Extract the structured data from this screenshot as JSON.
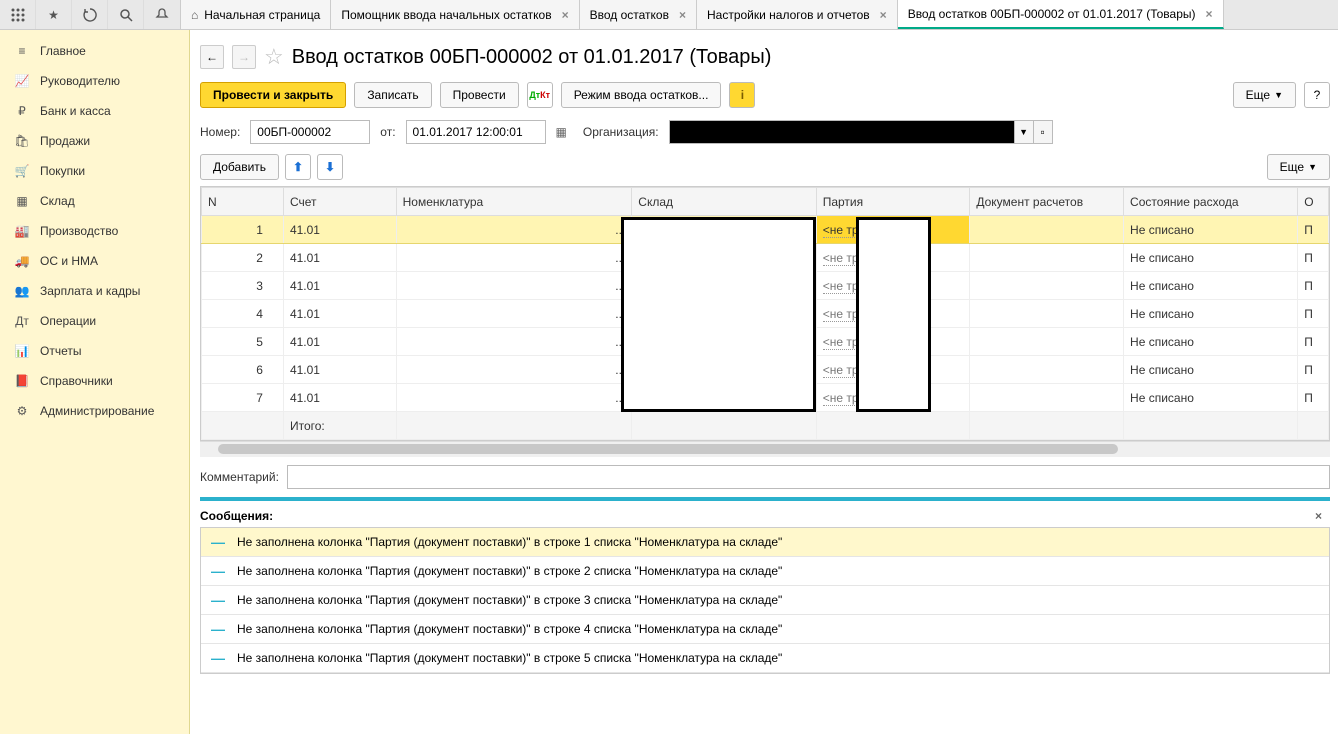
{
  "tabs": [
    {
      "label": "Начальная страница",
      "home": true
    },
    {
      "label": "Помощник ввода начальных остатков"
    },
    {
      "label": "Ввод остатков"
    },
    {
      "label": "Настройки налогов и отчетов"
    },
    {
      "label": "Ввод остатков 00БП-000002 от 01.01.2017 (Товары)",
      "active": true
    }
  ],
  "sidebar": [
    {
      "label": "Главное",
      "icon": "menu"
    },
    {
      "label": "Руководителю",
      "icon": "chart"
    },
    {
      "label": "Банк и касса",
      "icon": "ruble"
    },
    {
      "label": "Продажи",
      "icon": "bag"
    },
    {
      "label": "Покупки",
      "icon": "cart"
    },
    {
      "label": "Склад",
      "icon": "warehouse"
    },
    {
      "label": "Производство",
      "icon": "factory"
    },
    {
      "label": "ОС и НМА",
      "icon": "truck"
    },
    {
      "label": "Зарплата и кадры",
      "icon": "people"
    },
    {
      "label": "Операции",
      "icon": "dtkt"
    },
    {
      "label": "Отчеты",
      "icon": "bars"
    },
    {
      "label": "Справочники",
      "icon": "book"
    },
    {
      "label": "Администрирование",
      "icon": "gear"
    }
  ],
  "doc": {
    "title": "Ввод остатков 00БП-000002 от 01.01.2017 (Товары)"
  },
  "actions": {
    "post_and_close": "Провести и закрыть",
    "save": "Записать",
    "post": "Провести",
    "mode": "Режим ввода остатков...",
    "more": "Еще"
  },
  "fields": {
    "number_label": "Номер:",
    "number_value": "00БП-000002",
    "from_label": "от:",
    "date_value": "01.01.2017 12:00:01",
    "org_label": "Организация:"
  },
  "tbl_toolbar": {
    "add": "Добавить",
    "more": "Еще"
  },
  "columns": {
    "n": "N",
    "acct": "Счет",
    "nom": "Номенклатура",
    "skl": "Склад",
    "party": "Партия",
    "doc": "Документ расчетов",
    "state": "Состояние расхода",
    "o": "О"
  },
  "rows": [
    {
      "n": "1",
      "acct": "41.01",
      "party": "<не требуется>",
      "state": "Не списано",
      "o": "П",
      "selected": true
    },
    {
      "n": "2",
      "acct": "41.01",
      "party": "<не требуется>",
      "state": "Не списано",
      "o": "П"
    },
    {
      "n": "3",
      "acct": "41.01",
      "party": "<не требуется>",
      "state": "Не списано",
      "o": "П"
    },
    {
      "n": "4",
      "acct": "41.01",
      "party": "<не требуется>",
      "state": "Не списано",
      "o": "П"
    },
    {
      "n": "5",
      "acct": "41.01",
      "party": "<не требуется>",
      "state": "Не списано",
      "o": "П"
    },
    {
      "n": "6",
      "acct": "41.01",
      "party": "<не требуется>",
      "state": "Не списано",
      "o": "П"
    },
    {
      "n": "7",
      "acct": "41.01",
      "party": "<не требуется>",
      "state": "Не списано",
      "o": "П"
    }
  ],
  "footer_label": "Итого:",
  "comment_label": "Комментарий:",
  "messages": {
    "header": "Сообщения:",
    "items": [
      "Не заполнена колонка \"Партия (документ поставки)\" в строке 1 списка \"Номенклатура на складе\"",
      "Не заполнена колонка \"Партия (документ поставки)\" в строке 2 списка \"Номенклатура на складе\"",
      "Не заполнена колонка \"Партия (документ поставки)\" в строке 3 списка \"Номенклатура на складе\"",
      "Не заполнена колонка \"Партия (документ поставки)\" в строке 4 списка \"Номенклатура на складе\"",
      "Не заполнена колонка \"Партия (документ поставки)\" в строке 5 списка \"Номенклатура на складе\""
    ]
  }
}
